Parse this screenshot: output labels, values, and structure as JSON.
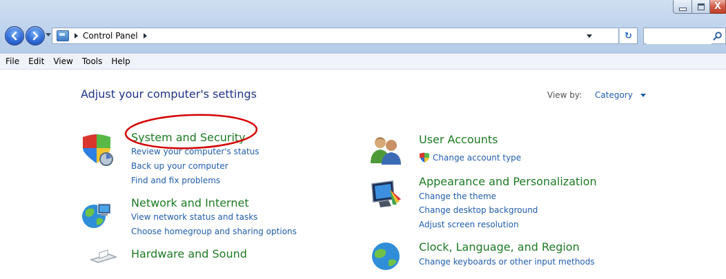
{
  "window": {
    "controls": {
      "minimize_icon": "minimize-icon",
      "maximize_icon": "maximize-icon",
      "close_label": "X"
    }
  },
  "toolbar": {
    "breadcrumb": [
      "Control Panel"
    ],
    "refresh_label": "↻",
    "search_placeholder": ""
  },
  "menu": [
    "File",
    "Edit",
    "View",
    "Tools",
    "Help"
  ],
  "main": {
    "title": "Adjust your computer's settings",
    "view_by_label": "View by:",
    "view_by_value": "Category",
    "left_categories": [
      {
        "title": "System and Security",
        "icon": "shield-icon",
        "links": [
          "Review your computer's status",
          "Back up your computer",
          "Find and fix problems"
        ]
      },
      {
        "title": "Network and Internet",
        "icon": "globe-network-icon",
        "links": [
          "View network status and tasks",
          "Choose homegroup and sharing options"
        ]
      },
      {
        "title": "Hardware and Sound",
        "icon": "printer-icon",
        "links": []
      }
    ],
    "right_categories": [
      {
        "title": "User Accounts",
        "icon": "users-icon",
        "links": [
          "Change account type"
        ]
      },
      {
        "title": "Appearance and Personalization",
        "icon": "monitor-paint-icon",
        "links": [
          "Change the theme",
          "Change desktop background",
          "Adjust screen resolution"
        ]
      },
      {
        "title": "Clock, Language, and Region",
        "icon": "globe-clock-icon",
        "links": [
          "Change keyboards or other input methods"
        ]
      }
    ]
  },
  "colors": {
    "category_title": "#1d7a23",
    "link": "#1f5dad",
    "heading": "#1e3287",
    "annotation": "#d40000"
  }
}
